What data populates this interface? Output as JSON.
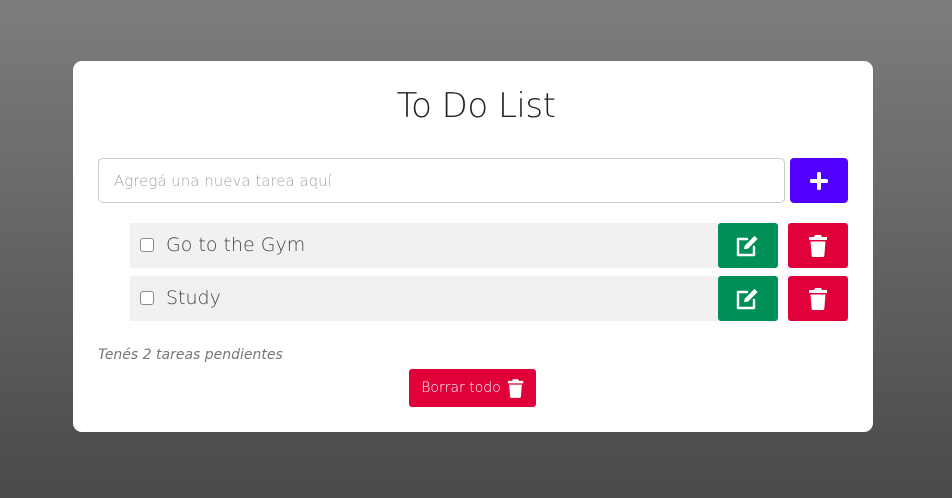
{
  "app": {
    "title": "To Do List"
  },
  "new_task": {
    "placeholder": "Agregá una nueva tarea aquí",
    "value": "",
    "add_icon": "plus-icon"
  },
  "tasks": [
    {
      "label": "Go to the Gym",
      "done": false,
      "edit_icon": "edit-icon",
      "delete_icon": "trash-icon"
    },
    {
      "label": "Study",
      "done": false,
      "edit_icon": "edit-icon",
      "delete_icon": "trash-icon"
    }
  ],
  "footer": {
    "pending_text": "Tenés 2 tareas pendientes",
    "clear_all_label": "Borrar todo",
    "clear_all_icon": "trash-icon"
  },
  "colors": {
    "add": "#5100ff",
    "edit": "#008f56",
    "delete": "#e0003a"
  }
}
